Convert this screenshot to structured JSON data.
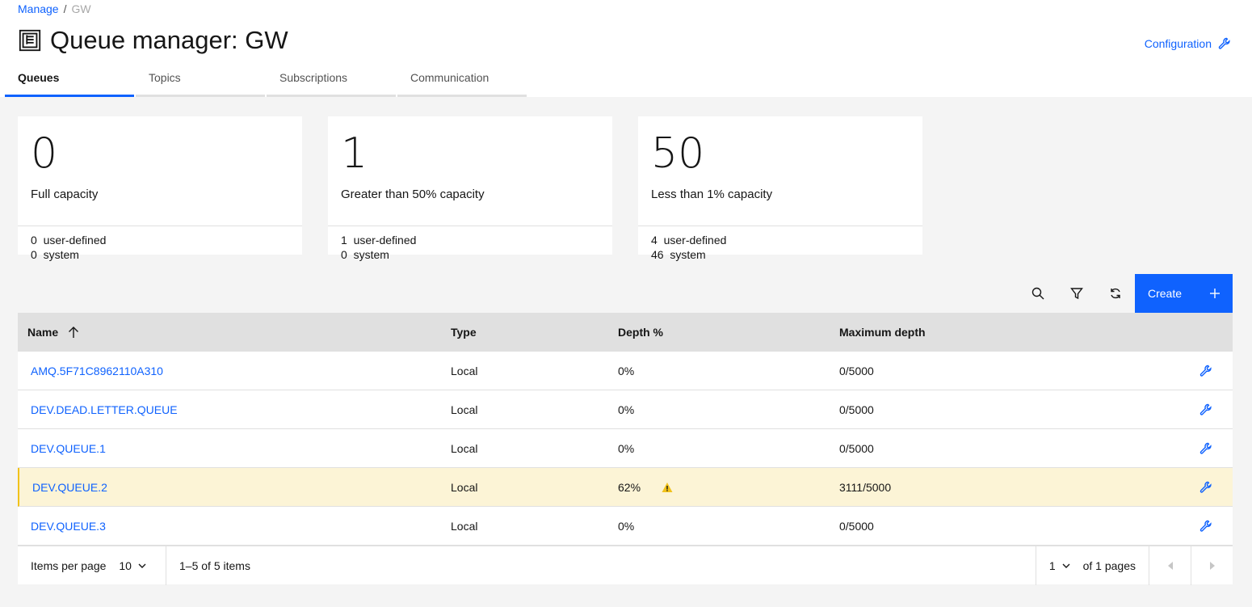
{
  "breadcrumb": {
    "parent": "Manage",
    "separator": "/",
    "current": "GW"
  },
  "page": {
    "title": "Queue manager: GW",
    "icon": "document-list-icon"
  },
  "config": {
    "label": "Configuration",
    "icon": "wrench-icon"
  },
  "tabs": [
    {
      "label": "Queues",
      "active": true
    },
    {
      "label": "Topics"
    },
    {
      "label": "Subscriptions"
    },
    {
      "label": "Communication"
    }
  ],
  "tiles": [
    {
      "value": "0",
      "label": "Full capacity",
      "user": "0",
      "user_label": "user-defined",
      "system": "0",
      "system_label": "system"
    },
    {
      "value": "1",
      "label": "Greater than 50% capacity",
      "user": "1",
      "user_label": "user-defined",
      "system": "0",
      "system_label": "system"
    },
    {
      "value": "50",
      "label": "Less than 1% capacity",
      "user": "4",
      "user_label": "user-defined",
      "system": "46",
      "system_label": "system"
    }
  ],
  "toolbar": {
    "create_label": "Create",
    "icons": [
      "search-icon",
      "filter-icon",
      "refresh-icon",
      "add-icon"
    ]
  },
  "table": {
    "headers": {
      "name": "Name",
      "type": "Type",
      "depth": "Depth %",
      "max": "Maximum depth"
    },
    "rows": [
      {
        "name": "AMQ.5F71C8962110A310",
        "type": "Local",
        "depth": "0%",
        "max": "0/5000"
      },
      {
        "name": "DEV.DEAD.LETTER.QUEUE",
        "type": "Local",
        "depth": "0%",
        "max": "0/5000"
      },
      {
        "name": "DEV.QUEUE.1",
        "type": "Local",
        "depth": "0%",
        "max": "0/5000"
      },
      {
        "name": "DEV.QUEUE.2",
        "type": "Local",
        "depth": "62%",
        "max": "3111/5000",
        "warning": true
      },
      {
        "name": "DEV.QUEUE.3",
        "type": "Local",
        "depth": "0%",
        "max": "0/5000"
      }
    ]
  },
  "pagination": {
    "items_per_page_label": "Items per page",
    "items_per_page": "10",
    "range": "1–5 of 5 items",
    "page": "1",
    "of_pages": "of 1 pages"
  },
  "colors": {
    "accent": "#0f62fe",
    "warning": "#f1c21b",
    "warning_row": "#fcf4d6"
  }
}
